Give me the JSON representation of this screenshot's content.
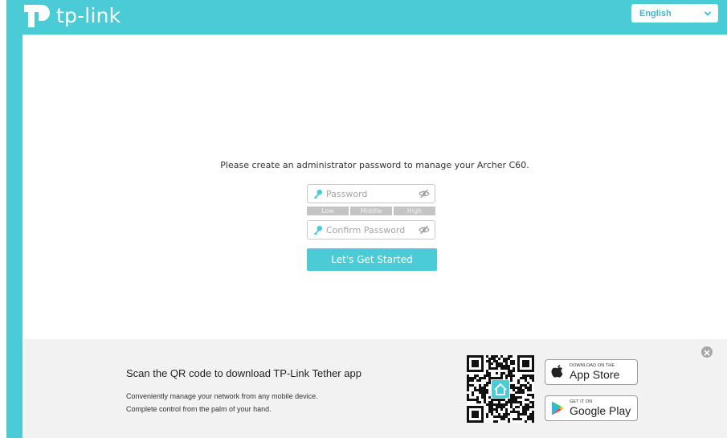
{
  "header": {
    "logo_text": "tp-link",
    "language": {
      "selected": "English"
    }
  },
  "setup": {
    "prompt": "Please create an administrator password to manage your Archer C60.",
    "password": {
      "placeholder": "Password",
      "value": ""
    },
    "strength_levels": [
      "Low",
      "Middle",
      "High"
    ],
    "confirm": {
      "placeholder": "Confirm Password",
      "value": ""
    },
    "submit_label": "Let's Get Started"
  },
  "footer": {
    "title": "Scan the QR code to download TP-Link Tether app",
    "lines": [
      "Conveniently manage your network from any mobile device.",
      "Complete control from the palm of your hand."
    ],
    "app_store": {
      "small": "DOWNLOAD ON THE",
      "big": "App Store"
    },
    "google_play": {
      "small": "GET IT ON",
      "big": "Google Play"
    }
  },
  "colors": {
    "brand": "#4acbd6",
    "footer_bg": "#f2f2f2",
    "strength_bar": "#c4c4c4"
  },
  "icons": {
    "password_field": "key-icon",
    "visibility_toggle": "eye-slash-icon",
    "language_dropdown": "chevron-down-icon",
    "close": "close-icon"
  }
}
